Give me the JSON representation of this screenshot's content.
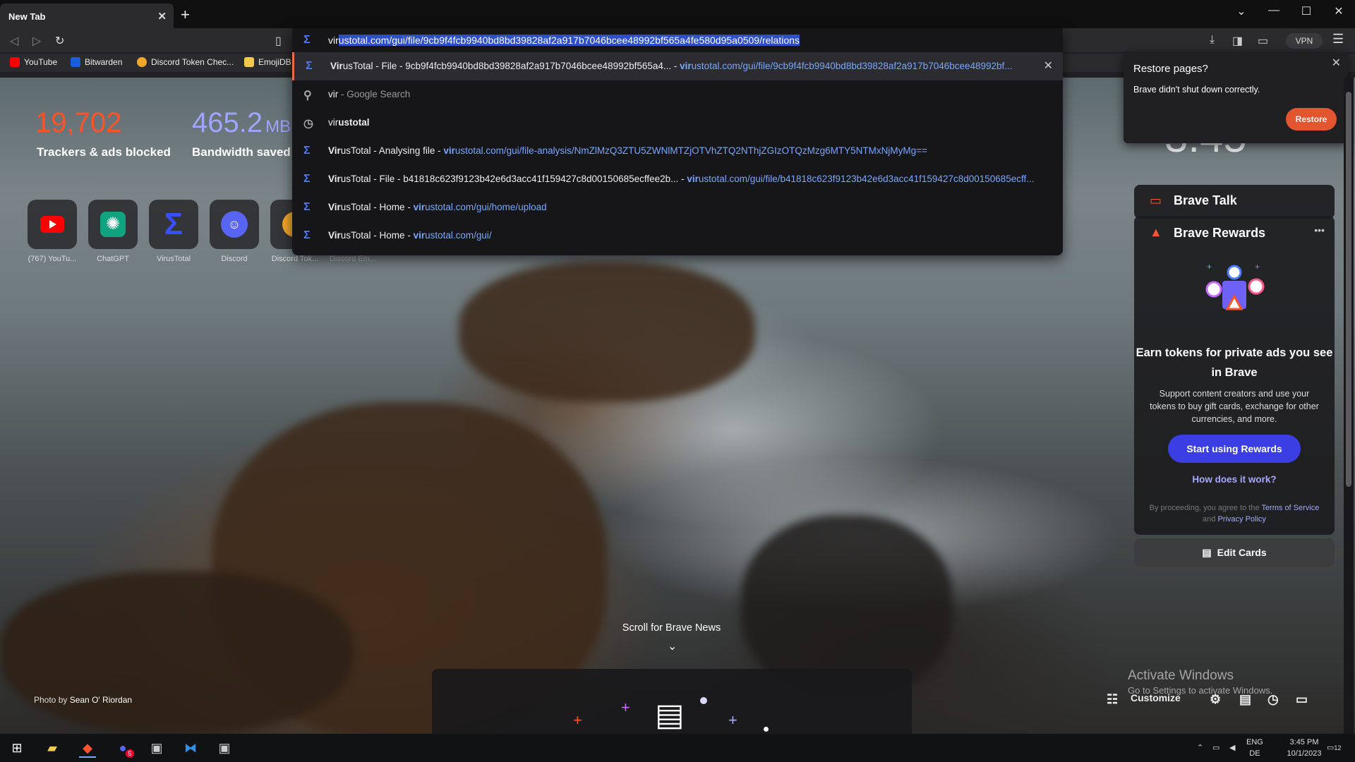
{
  "tab": {
    "title": "New Tab"
  },
  "window_controls": {
    "minimize": "—",
    "maximize": "☐",
    "close": "✕",
    "menu": "⌄"
  },
  "toolbar": {
    "vpn_label": "VPN"
  },
  "bookmarks": [
    {
      "label": "YouTube",
      "color": "#ff0000"
    },
    {
      "label": "Bitwarden",
      "color": "#175ddc"
    },
    {
      "label": "Discord Token Chec...",
      "color": "#f4a62a"
    },
    {
      "label": "EmojiDB",
      "color": "#f2c94c"
    }
  ],
  "omnibox": {
    "typed": "vir",
    "autocomplete": "ustotal.com/gui/file/9cb9f4fcb9940bd8bd39828af2a917b7046bcee48992bf565a4fe580d95a0509/relations",
    "suggestions": [
      {
        "bold": "Vir",
        "title": "usTotal - File - 9cb9f4fcb9940bd8bd39828af2a917b7046bcee48992bf565a4...",
        "sep": " - ",
        "url_bold": "vir",
        "url": "ustotal.com/gui/file/9cb9f4fcb9940bd8bd39828af2a917b7046bcee48992bf...",
        "icon": "virustotal-icon",
        "removable": true
      },
      {
        "bold": "vir",
        "title": "",
        "sep": " - ",
        "url_bold": "",
        "url": "Google Search",
        "icon": "search-icon"
      },
      {
        "bold": "vir",
        "title": "ustotal",
        "sep": "",
        "url_bold": "",
        "url": "",
        "icon": "history-icon"
      },
      {
        "bold": "Vir",
        "title": "usTotal - Analysing file",
        "sep": " - ",
        "url_bold": "vir",
        "url": "ustotal.com/gui/file-analysis/NmZlMzQ3ZTU5ZWNlMTZjOTVhZTQ2NThjZGIzOTQzMzg6MTY5NTMxNjMyMg==",
        "icon": "virustotal-icon"
      },
      {
        "bold": "Vir",
        "title": "usTotal - File - b41818c623f9123b42e6d3acc41f159427c8d00150685ecffee2b...",
        "sep": " - ",
        "url_bold": "vir",
        "url": "ustotal.com/gui/file/b41818c623f9123b42e6d3acc41f159427c8d00150685ecff...",
        "icon": "virustotal-icon"
      },
      {
        "bold": "Vir",
        "title": "usTotal - Home",
        "sep": " - ",
        "url_bold": "vir",
        "url": "ustotal.com/gui/home/upload",
        "icon": "virustotal-icon"
      },
      {
        "bold": "Vir",
        "title": "usTotal - Home",
        "sep": " - ",
        "url_bold": "vir",
        "url": "ustotal.com/gui/",
        "icon": "virustotal-icon"
      }
    ]
  },
  "stats": {
    "trackers_value": "19,702",
    "trackers_label": "Trackers & ads blocked",
    "bandwidth_value": "465.2",
    "bandwidth_unit": "MB",
    "bandwidth_label": "Bandwidth saved"
  },
  "top_sites": [
    {
      "label": "(767) YouTu...",
      "color": "#ff0000"
    },
    {
      "label": "ChatGPT",
      "color": "#10a37f"
    },
    {
      "label": "VirusTotal",
      "color": "#394eff"
    },
    {
      "label": "Discord",
      "color": "#5865f2"
    },
    {
      "label": "Discord Tok...",
      "color": "#f4a62a"
    },
    {
      "label": "Discord Em...",
      "color": "#f4a62a"
    }
  ],
  "restore": {
    "title": "Restore pages?",
    "message": "Brave didn't shut down correctly.",
    "button": "Restore"
  },
  "clock": "3:45",
  "cards": {
    "talk_title": "Brave Talk",
    "rewards_title": "Brave Rewards",
    "rewards_more": "•••",
    "heading": "Earn tokens for private ads you see in Brave",
    "body": "Support content creators and use your tokens to buy gift cards, exchange for other currencies, and more.",
    "cta": "Start using Rewards",
    "how": "How does it work?",
    "terms_pre": "By proceeding, you agree to the ",
    "terms_link": "Terms of Service",
    "terms_and": " and ",
    "privacy_link": "Privacy Policy",
    "edit_cards": "Edit Cards"
  },
  "scroll_news": "Scroll for Brave News",
  "photo_credit": {
    "prefix": "Photo by ",
    "author": "Sean O' Riordan"
  },
  "activate": {
    "line1": "Activate Windows",
    "line2": "Go to Settings to activate Windows."
  },
  "customize": "Customize",
  "taskbar": {
    "lang1": "ENG",
    "lang2": "DE",
    "time": "3:45 PM",
    "date": "10/1/2023",
    "notifications": "12",
    "discord_badge": "5"
  },
  "colors": {
    "accent": "#3b3ee3",
    "restore": "#e2552f",
    "link": "#7aa6ff"
  }
}
